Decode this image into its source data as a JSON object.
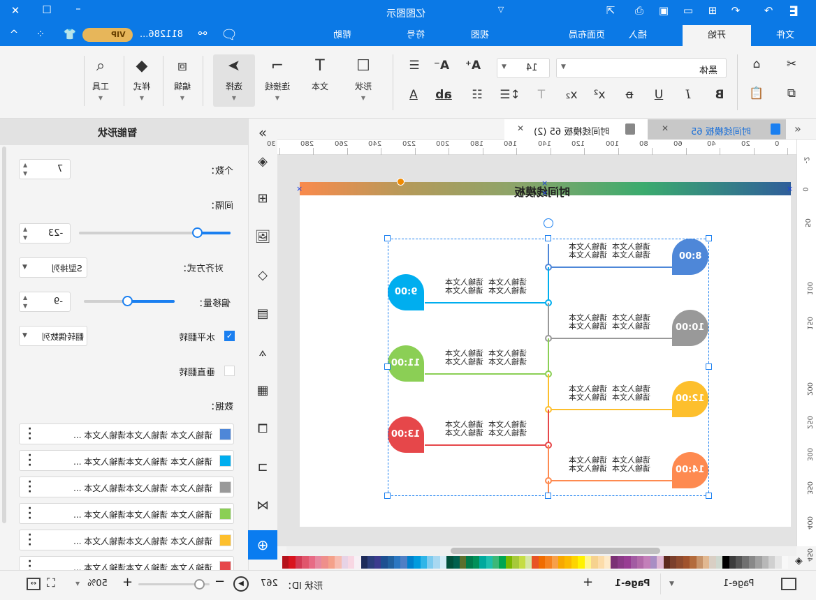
{
  "app": {
    "title": "亿图图示",
    "user": "811286...",
    "vip": "VIP"
  },
  "menu_tabs": [
    {
      "label": "文件"
    },
    {
      "label": "开始",
      "selected": true
    },
    {
      "label": "插入"
    },
    {
      "label": "页面布局"
    },
    {
      "label": "视图"
    },
    {
      "label": "符号"
    },
    {
      "label": "帮助"
    }
  ],
  "ribbon": {
    "font_family": "黑体",
    "font_size": "14",
    "shape": "形状",
    "text": "文本",
    "connector": "连接线",
    "select": "选择",
    "edit": "编辑",
    "style": "样式",
    "tools": "工具",
    "bold": "B",
    "italic": "I",
    "underline": "U"
  },
  "panel": {
    "title": "智能形状",
    "count_label": "个数：",
    "count": "7",
    "spacing_label": "间隔：",
    "spacing": "-23",
    "spacing_slider": 0.78,
    "align_label": "对齐方式：",
    "align": "S型排列",
    "offset_label": "偏移量：",
    "offset": "-9",
    "offset_slider": 0.48,
    "hflip_label": "水平翻转",
    "hflip": true,
    "hflip_mode": "翻转偶数列",
    "vflip_label": "垂直翻转",
    "vflip": false,
    "data_label": "数据：",
    "data_rows": [
      {
        "text": "请输入文本 请输入文本请输入文本 ...",
        "color": "#4e87d8"
      },
      {
        "text": "请输入文本 请输入文本请输入文本 ...",
        "color": "#00aeef"
      },
      {
        "text": "请输入文本 请输入文本请输入文本 ...",
        "color": "#999999"
      },
      {
        "text": "请输入文本 请输入文本请输入文本 ...",
        "color": "#8bcf55"
      },
      {
        "text": "请输入文本 请输入文本请输入文本 ...",
        "color": "#fdbf2d"
      },
      {
        "text": "请输入文本 请输入文本请输入文本 ...",
        "color": "#e6474a"
      }
    ]
  },
  "doc_tabs": [
    {
      "label": "时间线模板 65",
      "active": true
    },
    {
      "label": "时间线模板 65 (2)",
      "active": false
    }
  ],
  "ruler_h": [
    "0",
    "20",
    "40",
    "60",
    "80",
    "100",
    "120",
    "140",
    "160",
    "180",
    "200",
    "220",
    "240",
    "260",
    "280",
    "30"
  ],
  "ruler_v": [
    "-2",
    "0",
    "50",
    "100",
    "150",
    "200",
    "250",
    "300",
    "350",
    "400",
    "450",
    "500"
  ],
  "canvas": {
    "title": "时间线模板",
    "item_text": "请输入文本  请输入文本\n请输入文本  请输入文本",
    "items": [
      {
        "time": "8:00",
        "color": "#4e87d8"
      },
      {
        "time": "9:00",
        "color": "#00aeef"
      },
      {
        "time": "10:00",
        "color": "#999999"
      },
      {
        "time": "11:00",
        "color": "#8bcf55"
      },
      {
        "time": "12:00",
        "color": "#fdbf2d"
      },
      {
        "time": "13:00",
        "color": "#e6474a"
      },
      {
        "time": "14:00",
        "color": "#fe8a50"
      }
    ]
  },
  "palette": [
    "#b5121b",
    "#d9141e",
    "#d23a54",
    "#e0566c",
    "#e76b85",
    "#e788a0",
    "#ef8f8b",
    "#f4a18a",
    "#f7bcb0",
    "#e7d3e6",
    "#f8d7e3",
    "#f7f0f5",
    "#1d2b5a",
    "#2c3e7c",
    "#3c3b8e",
    "#1d4f91",
    "#21619f",
    "#2b77c1",
    "#4f7fc5",
    "#0080cc",
    "#009bde",
    "#2fb5e8",
    "#7ecbef",
    "#a8d8f1",
    "#d4ecf7",
    "#00503b",
    "#00604e",
    "#5b6f2d",
    "#007a4b",
    "#009058",
    "#00a99d",
    "#1ebfae",
    "#3cb878",
    "#00a651",
    "#7ab800",
    "#a6c93a",
    "#c5dd44",
    "#d6e7a5",
    "#e85325",
    "#f06c00",
    "#f58220",
    "#f7a04a",
    "#f7a800",
    "#fbb900",
    "#fdd400",
    "#fff200",
    "#fff58c",
    "#f6d28e",
    "#fcdca9",
    "#feeac9",
    "#7b3175",
    "#8b3a87",
    "#983d93",
    "#a25ba2",
    "#b26aa9",
    "#c37fb9",
    "#a98ec4",
    "#e0b7d4",
    "#5e2a1e",
    "#7b3f2c",
    "#8e4a2e",
    "#a0522d",
    "#b36b3c",
    "#c8946a",
    "#e1b891",
    "#d9cfc4",
    "#cfd8cf",
    "#000000",
    "#3c3c3c",
    "#555555",
    "#707070",
    "#888888",
    "#a0a0a0",
    "#b8b8b8",
    "#d0d0d0",
    "#e6e6e6",
    "#f8f8f8"
  ],
  "status": {
    "page_tab": "Page-1",
    "page_current": "Page-1",
    "shape_id_label": "形状 ID：",
    "shape_id": "267",
    "zoom": "50%",
    "zoom_slider": 0.85
  }
}
